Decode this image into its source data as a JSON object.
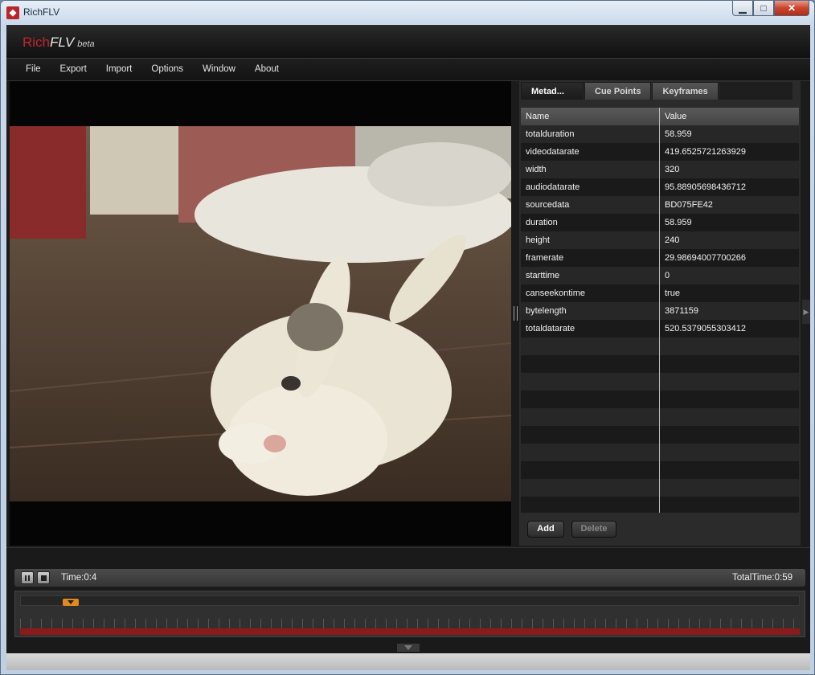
{
  "window": {
    "title": "RichFLV",
    "minimize": "▁",
    "maximize": "□",
    "close": "✕",
    "icon": "app-icon"
  },
  "header": {
    "logo_rich": "Rich",
    "logo_flv": "FLV",
    "logo_beta": "beta"
  },
  "menu": [
    "File",
    "Export",
    "Import",
    "Options",
    "Window",
    "About"
  ],
  "tabs": [
    {
      "label": "Metad...",
      "active": true
    },
    {
      "label": "Cue Points",
      "active": false
    },
    {
      "label": "Keyframes",
      "active": false
    }
  ],
  "metadata": {
    "columns": [
      "Name",
      "Value"
    ],
    "rows": [
      [
        "totalduration",
        "58.959"
      ],
      [
        "videodatarate",
        "419.6525721263929"
      ],
      [
        "width",
        "320"
      ],
      [
        "audiodatarate",
        "95.88905698436712"
      ],
      [
        "sourcedata",
        "BD075FE42"
      ],
      [
        "duration",
        "58.959"
      ],
      [
        "height",
        "240"
      ],
      [
        "framerate",
        "29.98694007700266"
      ],
      [
        "starttime",
        "0"
      ],
      [
        "canseekontime",
        "true"
      ],
      [
        "bytelength",
        "3871159"
      ],
      [
        "totaldatarate",
        "520.5379055303412"
      ]
    ],
    "add_label": "Add",
    "delete_label": "Delete"
  },
  "player": {
    "time": "Time:0:4",
    "total_time": "TotalTime:0:59"
  }
}
